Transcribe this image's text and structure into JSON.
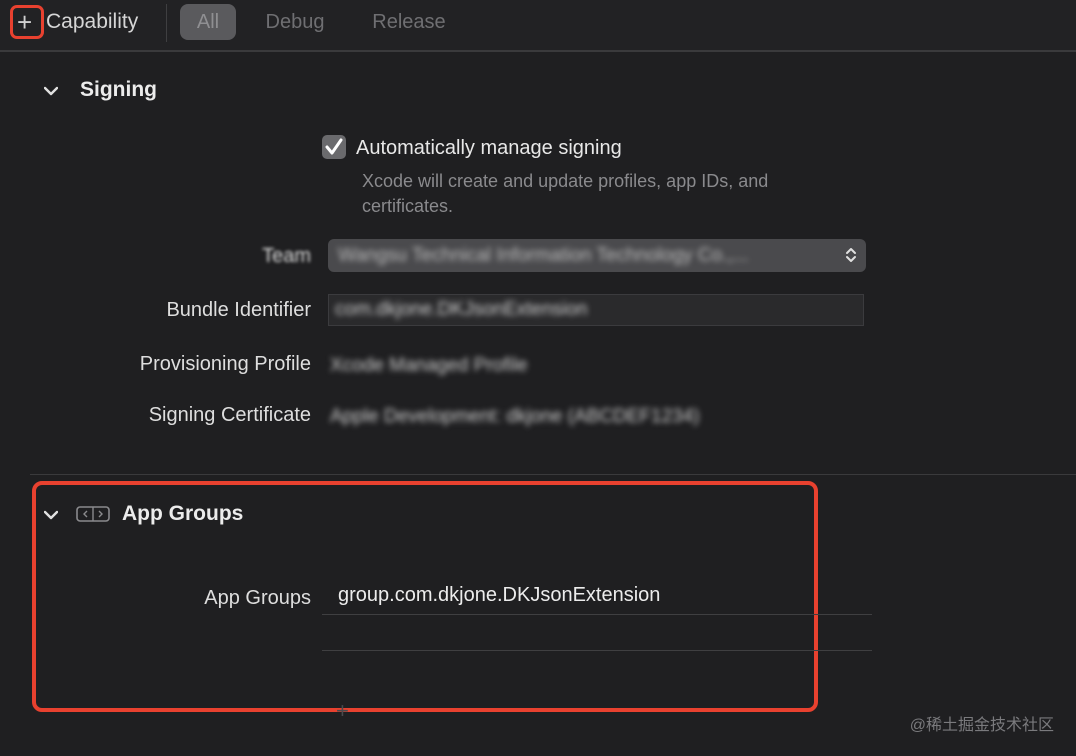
{
  "toolbar": {
    "add_symbol": "+",
    "capability_label": "Capability",
    "filters": [
      "All",
      "Debug",
      "Release"
    ],
    "active_filter": "All"
  },
  "signing": {
    "title": "Signing",
    "auto_manage_label": "Automatically manage signing",
    "auto_manage_checked": true,
    "auto_manage_description": "Xcode will create and update profiles, app IDs, and certificates.",
    "team_label": "Team",
    "team_value": "Wangsu Technical Information Technology Co.,...",
    "bundle_label": "Bundle Identifier",
    "bundle_value": "com.dkjone.DKJsonExtension",
    "profile_label": "Provisioning Profile",
    "profile_value": "Xcode Managed Profile",
    "certificate_label": "Signing Certificate",
    "certificate_value": "Apple Development: dkjone (ABCDEF1234)"
  },
  "app_groups": {
    "title": "App Groups",
    "label": "App Groups",
    "items": [
      "group.com.dkjone.DKJsonExtension",
      ""
    ]
  },
  "watermark": "@稀土掘金技术社区",
  "colors": {
    "highlight": "#e8412f",
    "background": "#1f1f21"
  }
}
